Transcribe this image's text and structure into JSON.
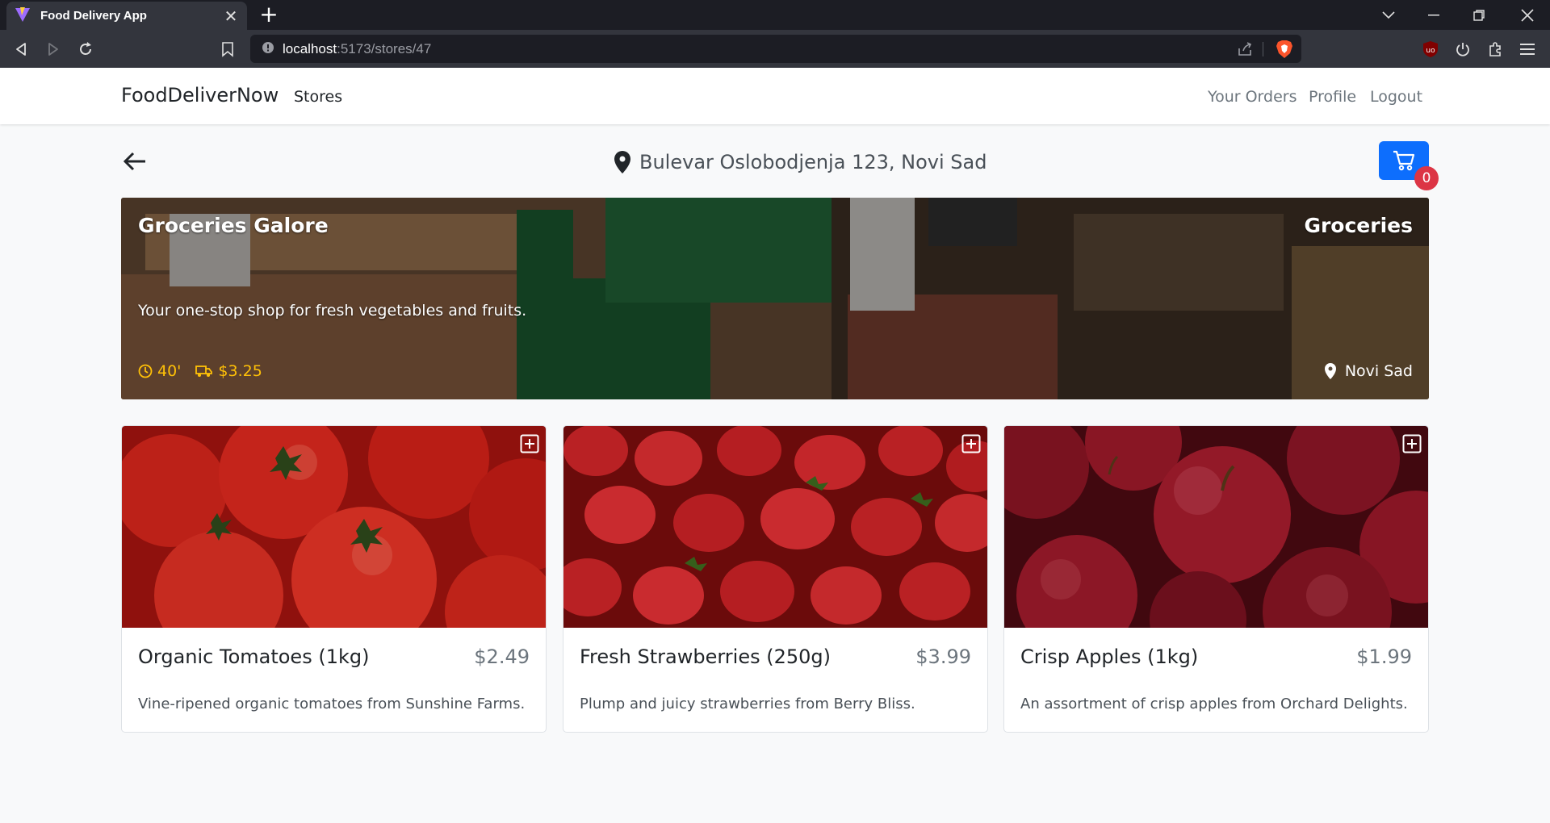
{
  "browser": {
    "tab_title": "Food Delivery App",
    "url_host": "localhost",
    "url_path": ":5173/stores/47"
  },
  "navbar": {
    "brand": "FoodDeliverNow",
    "stores_link": "Stores",
    "orders_link": "Your Orders",
    "profile_link": "Profile",
    "logout_link": "Logout"
  },
  "header": {
    "address": "Bulevar Oslobodjenja 123, Novi Sad",
    "cart_count": "0"
  },
  "store": {
    "name": "Groceries Galore",
    "category": "Groceries",
    "description": "Your one-stop shop for fresh vegetables and fruits.",
    "delivery_time": "40'",
    "delivery_fee": "$3.25",
    "city": "Novi Sad"
  },
  "products": [
    {
      "name": "Organic Tomatoes (1kg)",
      "price": "$2.49",
      "description": "Vine-ripened organic tomatoes from Sunshine Farms."
    },
    {
      "name": "Fresh Strawberries (250g)",
      "price": "$3.99",
      "description": "Plump and juicy strawberries from Berry Bliss."
    },
    {
      "name": "Crisp Apples (1kg)",
      "price": "$1.99",
      "description": "An assortment of crisp apples from Orchard Delights."
    }
  ],
  "colors": {
    "primary": "#0d6efd",
    "badge": "#dc3545",
    "meta": "#ffc107"
  }
}
